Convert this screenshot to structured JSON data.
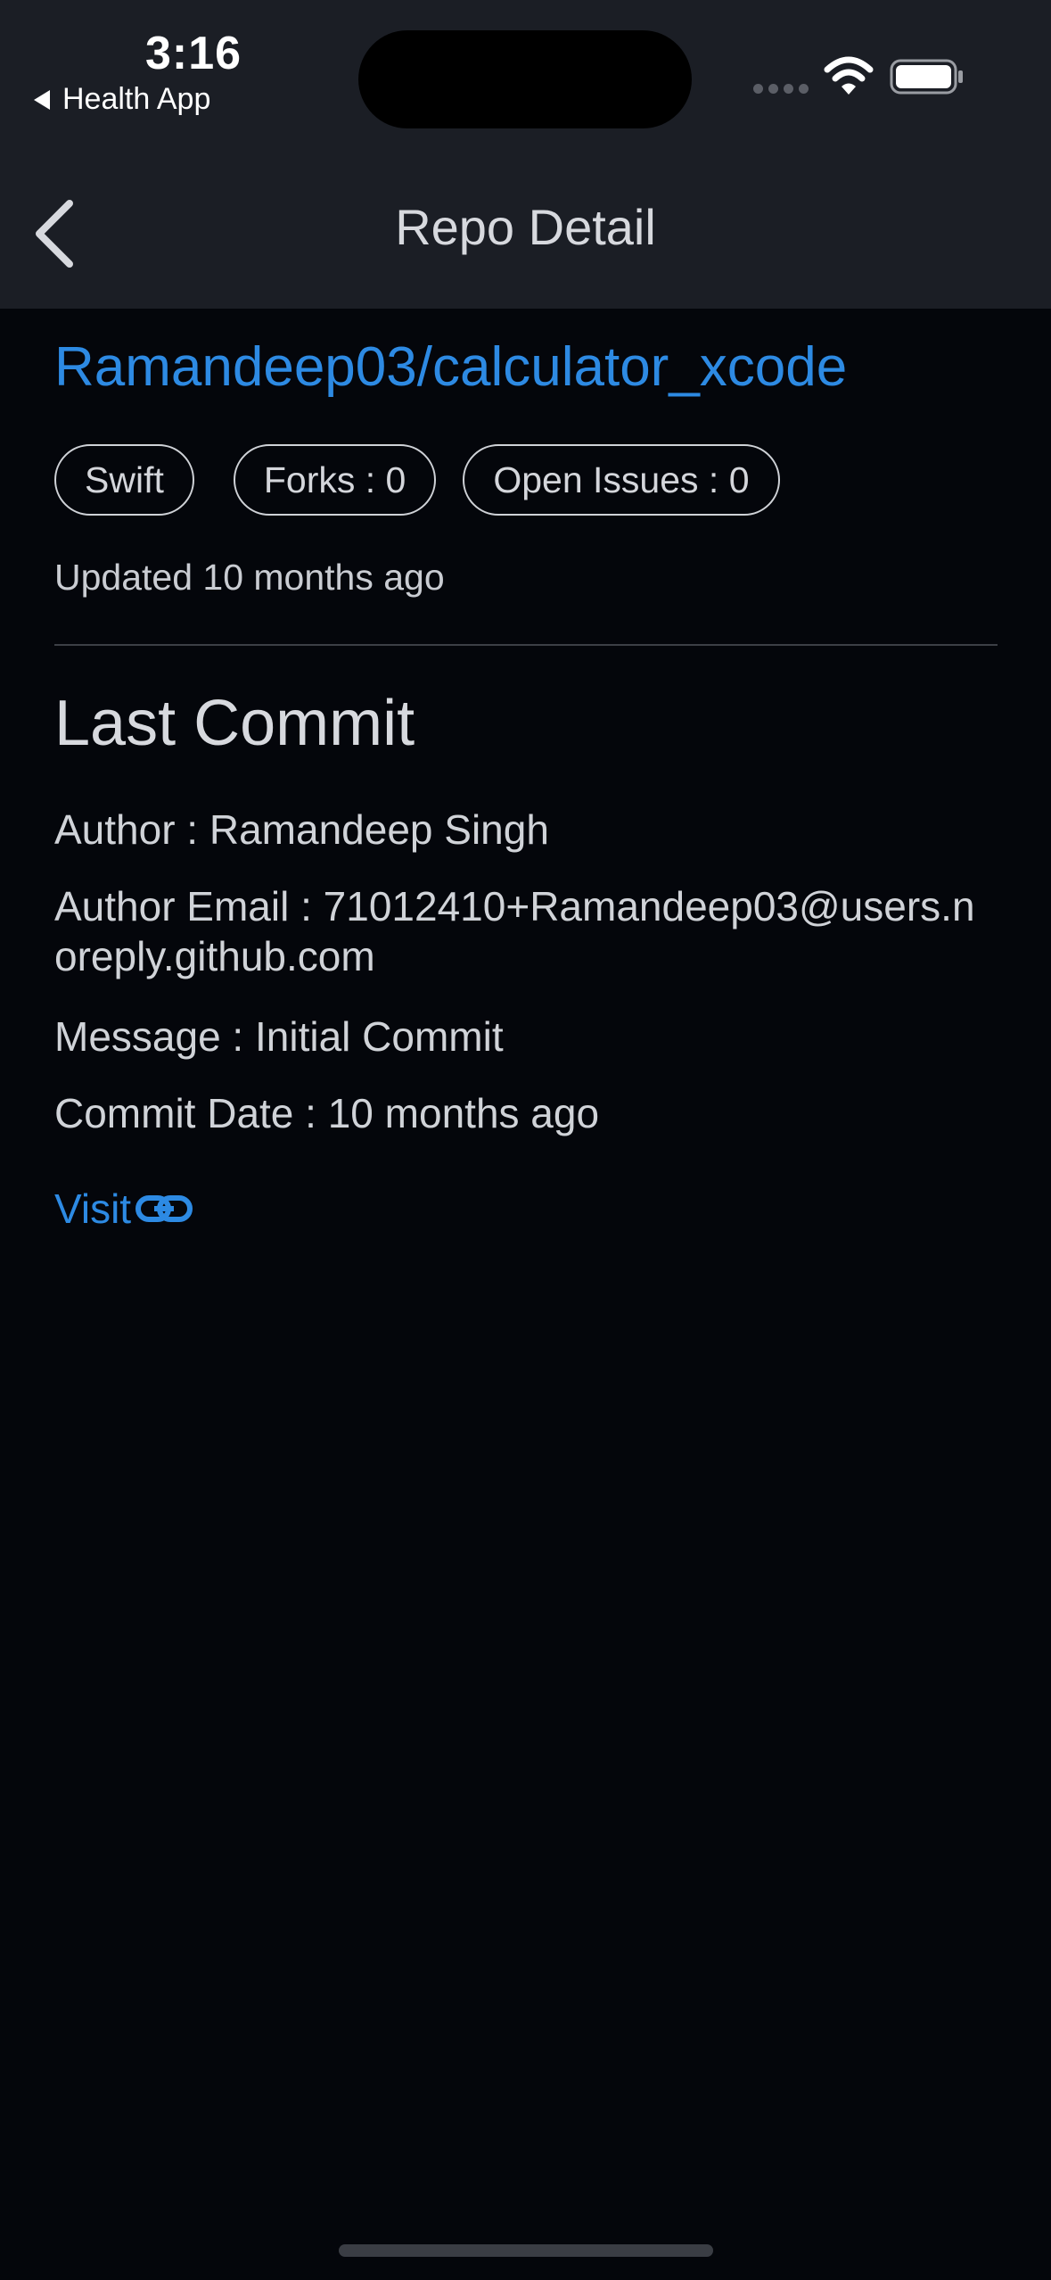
{
  "status_bar": {
    "time": "3:16",
    "back_app_label": "Health App"
  },
  "nav": {
    "title": "Repo Detail"
  },
  "repo": {
    "full_name": "Ramandeep03/calculator_xcode",
    "chips": {
      "language": "Swift",
      "forks": "Forks : 0",
      "open_issues": "Open Issues : 0"
    },
    "updated": "Updated 10 months ago"
  },
  "last_commit": {
    "section_title": "Last Commit",
    "author": "Author : Ramandeep Singh",
    "author_email": "Author Email : 71012410+Ramandeep03@users.noreply.github.com",
    "message": "Message : Initial Commit",
    "commit_date": "Commit Date : 10 months ago",
    "visit_label": "Visit"
  },
  "colors": {
    "accent": "#2d8ae3",
    "header_bg": "#1b1e25",
    "page_bg": "#04060b"
  },
  "icons": {
    "back": "chevron-left-icon",
    "link": "link-icon",
    "wifi": "wifi-icon",
    "battery": "battery-icon"
  }
}
